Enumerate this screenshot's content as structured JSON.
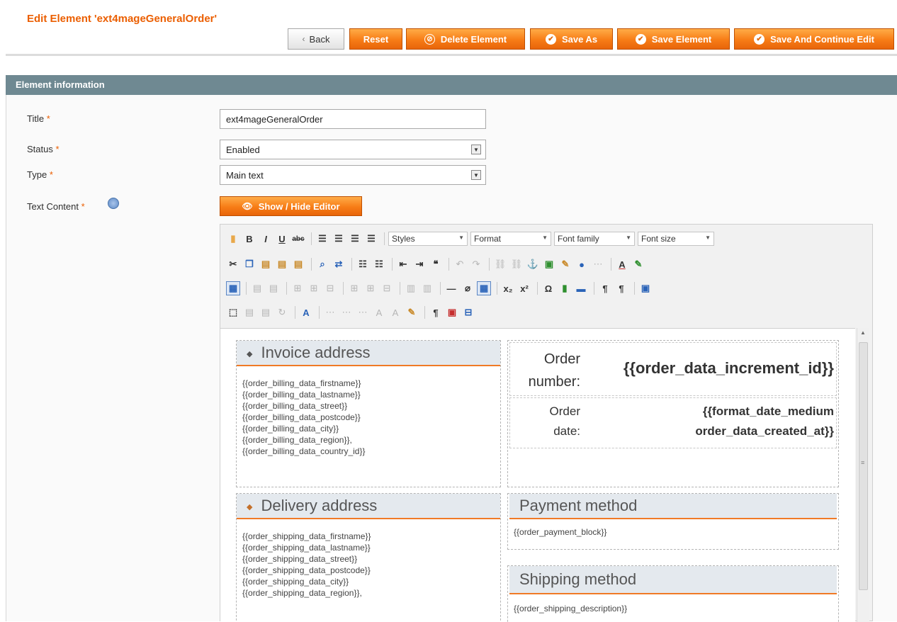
{
  "header": {
    "title": "Edit Element 'ext4mageGeneralOrder'",
    "buttons": {
      "back": "Back",
      "reset": "Reset",
      "delete": "Delete Element",
      "save_as": "Save As",
      "save_element": "Save Element",
      "save_continue": "Save And Continue Edit"
    }
  },
  "section": {
    "title": "Element information"
  },
  "form": {
    "title_label": "Title",
    "title_value": "ext4mageGeneralOrder",
    "status_label": "Status",
    "status_value": "Enabled",
    "type_label": "Type",
    "type_value": "Main text",
    "text_content_label": "Text Content",
    "required_mark": "*",
    "show_hide_editor": "Show / Hide Editor"
  },
  "editor": {
    "toolbar": {
      "styles": "Styles",
      "format": "Format",
      "font_family": "Font family",
      "font_size": "Font size"
    },
    "content": {
      "invoice_heading": "Invoice address",
      "invoice_lines": [
        "{{order_billing_data_firstname}}",
        "{{order_billing_data_lastname}}",
        "{{order_billing_data_street}}",
        "{{order_billing_data_postcode}}",
        "{{order_billing_data_city}}",
        "{{order_billing_data_region}},",
        "{{order_billing_data_country_id}}"
      ],
      "order_number_label_1": "Order",
      "order_number_label_2": "number:",
      "order_number_value": "{{order_data_increment_id}}",
      "order_date_label_1": "Order",
      "order_date_label_2": "date:",
      "order_date_value_1": "{{format_date_medium",
      "order_date_value_2": "order_data_created_at}}",
      "delivery_heading": "Delivery address",
      "delivery_lines": [
        "{{order_shipping_data_firstname}}",
        "{{order_shipping_data_lastname}}",
        "{{order_shipping_data_street}}",
        "{{order_shipping_data_postcode}}",
        "{{order_shipping_data_city}}",
        "{{order_shipping_data_region}},"
      ],
      "payment_heading": "Payment method",
      "payment_value": "{{order_payment_block}}",
      "shipping_heading": "Shipping method",
      "shipping_value": "{{order_shipping_description}}"
    }
  },
  "colors": {
    "accent": "#eb5e00",
    "section_header": "#6f8992",
    "box_head": "#e4e9ee"
  }
}
